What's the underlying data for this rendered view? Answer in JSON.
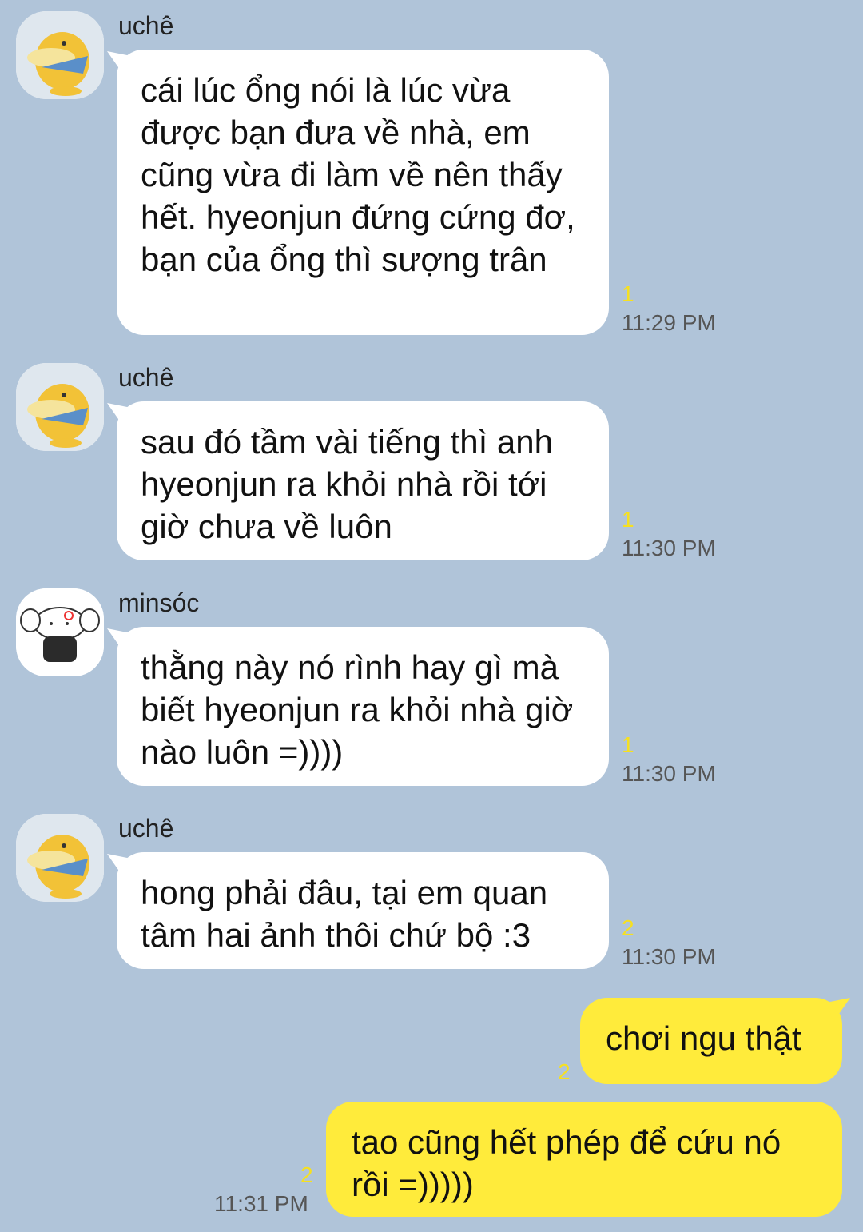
{
  "colors": {
    "background": "#b0c4d9",
    "incoming_bubble": "#ffffff",
    "outgoing_bubble": "#ffeb3b",
    "unread_count": "#f6e020"
  },
  "messages": [
    {
      "sender": "uchê",
      "avatar": "psyduck-avatar",
      "text": "cái lúc ổng nói là lúc vừa được bạn đưa về nhà, em cũng vừa đi làm về nên thấy hết. hyeonjun đứng cứng đơ, bạn của ổng thì sượng trân",
      "unread": "1",
      "time": "11:29 PM"
    },
    {
      "sender": "uchê",
      "avatar": "psyduck-avatar",
      "text": "sau đó tầm vài tiếng thì anh hyeonjun ra khỏi nhà rồi tới giờ chưa về luôn",
      "unread": "1",
      "time": "11:30 PM"
    },
    {
      "sender": "minsóc",
      "avatar": "puppy-avatar",
      "text": "thằng này nó rình hay gì mà biết hyeonjun ra khỏi nhà giờ nào luôn =))))",
      "unread": "1",
      "time": "11:30 PM"
    },
    {
      "sender": "uchê",
      "avatar": "psyduck-avatar",
      "text": "hong phải đâu, tại em quan tâm hai ảnh thôi chứ bộ :3",
      "unread": "2",
      "time": "11:30 PM"
    },
    {
      "sender": "me",
      "text": "chơi ngu thật",
      "unread": "2",
      "time": ""
    },
    {
      "sender": "me",
      "text": "tao cũng hết phép để cứu nó rồi =)))))",
      "unread": "2",
      "time": "11:31 PM"
    }
  ]
}
